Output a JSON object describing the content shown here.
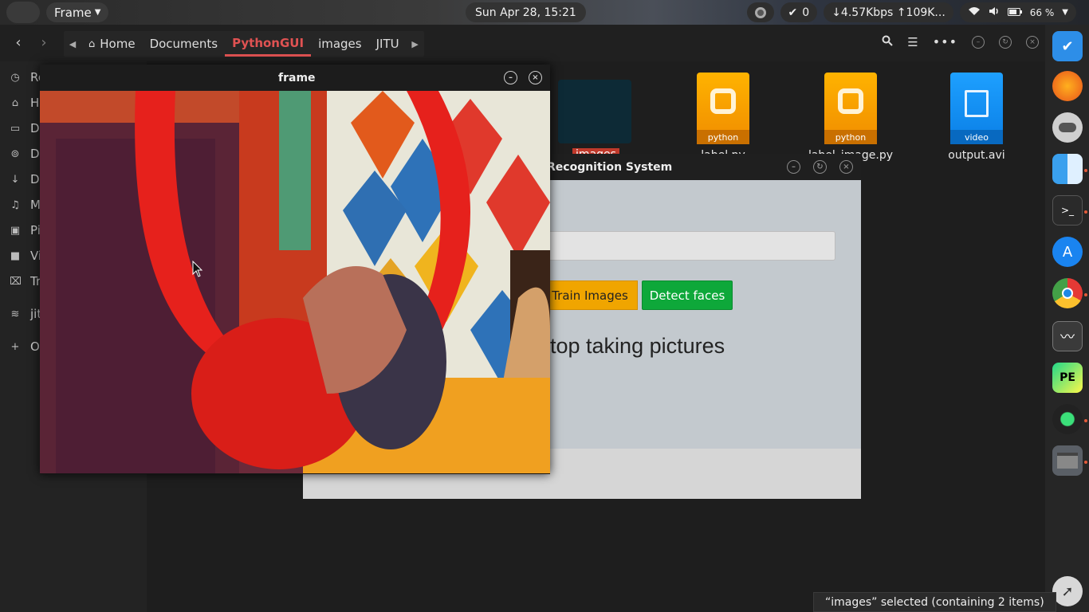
{
  "topbar": {
    "app_menu": "Frame",
    "clock": "Sun Apr 28, 15:21",
    "check_count": "0",
    "net_speed": "↓4.57Kbps ↑109K...",
    "battery": "66 %"
  },
  "file_manager": {
    "breadcrumbs": [
      {
        "label": "Home"
      },
      {
        "label": "Documents"
      },
      {
        "label": "PythonGUI"
      },
      {
        "label": "images"
      },
      {
        "label": "JITU"
      }
    ],
    "sidebar": [
      {
        "label": "Re",
        "icon": "clock-icon"
      },
      {
        "label": "Ho",
        "icon": "home-icon"
      },
      {
        "label": "De",
        "icon": "desktop-icon"
      },
      {
        "label": "Do",
        "icon": "disc-icon"
      },
      {
        "label": "Do",
        "icon": "download-icon"
      },
      {
        "label": "M",
        "icon": "music-icon"
      },
      {
        "label": "Pi",
        "icon": "picture-icon"
      },
      {
        "label": "Vi",
        "icon": "video-icon"
      },
      {
        "label": "Tr",
        "icon": "trash-icon"
      },
      {
        "label": "jit",
        "icon": "wifi-icon"
      },
      {
        "label": "O",
        "icon": "plus-icon"
      }
    ],
    "files": [
      {
        "name": "images",
        "type": "folder"
      },
      {
        "name": "label.py",
        "type_label": "python"
      },
      {
        "name": "label_image.py",
        "type_label": "python"
      },
      {
        "name": "output.avi",
        "type_label": "video"
      }
    ],
    "status": "“images” selected  (containing 2 items)"
  },
  "frame_window": {
    "title": "frame"
  },
  "recognition_window": {
    "title": "Recognition System",
    "train_button": "Train Images",
    "detect_button": "Detect faces",
    "message": "top taking pictures"
  },
  "colors": {
    "accent_red": "#e05252",
    "train_orange": "#f0a500",
    "detect_green": "#0ea83a"
  }
}
